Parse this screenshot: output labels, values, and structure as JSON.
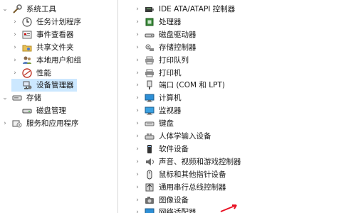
{
  "left_tree": [
    {
      "label": "系统工具",
      "expanded": true,
      "icon": "system-tools-icon"
    },
    {
      "label": "任务计划程序",
      "expanded": false,
      "icon": "task-scheduler-icon"
    },
    {
      "label": "事件查看器",
      "expanded": false,
      "icon": "event-viewer-icon"
    },
    {
      "label": "共享文件夹",
      "expanded": false,
      "icon": "shared-folders-icon"
    },
    {
      "label": "本地用户和组",
      "expanded": false,
      "icon": "users-groups-icon"
    },
    {
      "label": "性能",
      "expanded": false,
      "icon": "performance-icon"
    },
    {
      "label": "设备管理器",
      "expanded": null,
      "icon": "device-manager-icon",
      "selected": true
    },
    {
      "label": "存储",
      "expanded": true,
      "icon": "storage-icon"
    },
    {
      "label": "磁盘管理",
      "expanded": null,
      "icon": "disk-management-icon"
    },
    {
      "label": "服务和应用程序",
      "expanded": false,
      "icon": "services-apps-icon"
    }
  ],
  "device_categories": [
    {
      "label": "IDE ATA/ATAPI 控制器",
      "icon": "ide-controller-icon"
    },
    {
      "label": "处理器",
      "icon": "processor-icon"
    },
    {
      "label": "磁盘驱动器",
      "icon": "disk-drive-icon"
    },
    {
      "label": "存储控制器",
      "icon": "storage-controller-icon"
    },
    {
      "label": "打印队列",
      "icon": "print-queue-icon"
    },
    {
      "label": "打印机",
      "icon": "printer-icon"
    },
    {
      "label": "端口 (COM 和 LPT)",
      "icon": "port-icon"
    },
    {
      "label": "计算机",
      "icon": "computer-icon"
    },
    {
      "label": "监视器",
      "icon": "monitor-icon"
    },
    {
      "label": "键盘",
      "icon": "keyboard-icon"
    },
    {
      "label": "人体学输入设备",
      "icon": "hid-icon"
    },
    {
      "label": "软件设备",
      "icon": "software-device-icon"
    },
    {
      "label": "声音、视频和游戏控制器",
      "icon": "sound-icon"
    },
    {
      "label": "鼠标和其他指针设备",
      "icon": "mouse-icon"
    },
    {
      "label": "通用串行总线控制器",
      "icon": "usb-icon"
    },
    {
      "label": "图像设备",
      "icon": "imaging-device-icon"
    },
    {
      "label": "网络适配器",
      "icon": "network-adapter-icon"
    }
  ],
  "colors": {
    "selection": "#cce8ff",
    "accent": "#0078d7",
    "annotation": "#e81123"
  }
}
